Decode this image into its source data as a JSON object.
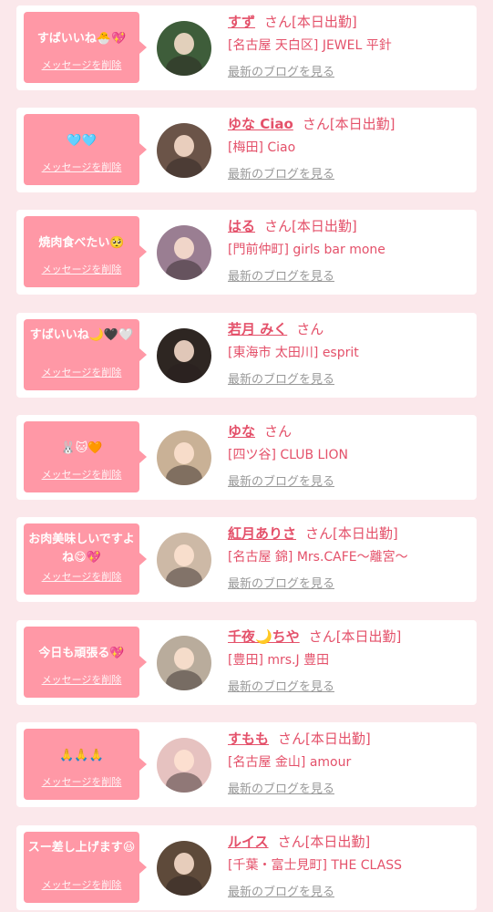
{
  "delete_label": "メッセージを削除",
  "blog_label": "最新のブログを見る",
  "honorific": "さん",
  "colors": {
    "page_bg": "#fbe8eb",
    "bubble": "#ff98a6",
    "accent_text": "#e4516a",
    "link_gray": "#999999"
  },
  "messages": [
    {
      "text": "すばいいね🐣💖",
      "name": "すず",
      "status": "[本日出勤]",
      "shop": "[名古屋 天白区] JEWEL 平針",
      "avatar_color": "#3e5d3a"
    },
    {
      "text": "🩵🩵",
      "name": "ゆな Ciao",
      "status": "[本日出勤]",
      "shop": "[梅田] Ciao",
      "avatar_color": "#6b5448"
    },
    {
      "text": "焼肉食べたい🥺",
      "name": "はる",
      "status": "[本日出勤]",
      "shop": "[門前仲町] girls bar mone",
      "avatar_color": "#9a7e92"
    },
    {
      "text": "すばいいね🌙🖤🤍",
      "name": "若月 みく",
      "status": "",
      "shop": "[東海市 太田川] esprit",
      "avatar_color": "#2e2622"
    },
    {
      "text": "🐰🐱🧡",
      "name": "ゆな",
      "status": "",
      "shop": "[四ツ谷] CLUB LION",
      "avatar_color": "#c9b196"
    },
    {
      "text": "お肉美味しいですよね😋💖",
      "name": "紅月ありさ",
      "status": "[本日出勤]",
      "shop": "[名古屋 錦] Mrs.CAFE〜離宮〜",
      "avatar_color": "#cdb9a6"
    },
    {
      "text": "今日も頑張る💖",
      "name": "千夜🌙ちや",
      "status": "[本日出勤]",
      "shop": "[豊田] mrs.J 豊田",
      "avatar_color": "#b9ac9c"
    },
    {
      "text": "🙏🙏🙏",
      "name": "すもも",
      "status": "[本日出勤]",
      "shop": "[名古屋 金山] amour",
      "avatar_color": "#e6c2c0"
    },
    {
      "text": "スー差し上げます😆",
      "name": "ルイス",
      "status": "[本日出勤]",
      "shop": "[千葉・富士見町] THE CLASS",
      "avatar_color": "#5e4a3a"
    }
  ]
}
